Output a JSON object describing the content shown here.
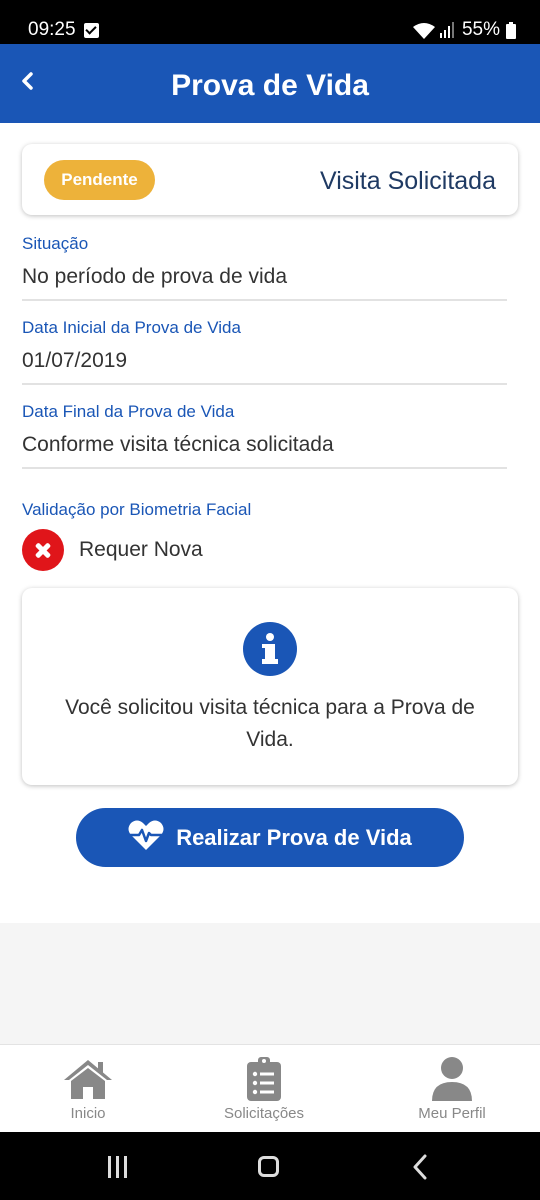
{
  "status_bar": {
    "time": "09:25",
    "battery": "55%"
  },
  "header": {
    "title": "Prova de Vida"
  },
  "status_card": {
    "badge": "Pendente",
    "status": "Visita Solicitada"
  },
  "fields": [
    {
      "label": "Situação",
      "value": "No período de prova de vida"
    },
    {
      "label": "Data Inicial da Prova de Vida",
      "value": "01/07/2019"
    },
    {
      "label": "Data Final da Prova de Vida",
      "value": "Conforme visita técnica solicitada"
    }
  ],
  "biometry": {
    "label": "Validação por Biometria Facial",
    "status": "Requer Nova"
  },
  "info_card": {
    "message": "Você solicitou visita técnica para a Prova de Vida."
  },
  "action_button": {
    "label": "Realizar Prova de Vida"
  },
  "bottom_nav": [
    {
      "label": "Inicio",
      "icon": "home-icon"
    },
    {
      "label": "Solicitações",
      "icon": "clipboard-list-icon"
    },
    {
      "label": "Meu Perfil",
      "icon": "user-icon"
    }
  ],
  "colors": {
    "primary": "#1a56b6",
    "badge": "#edb23a",
    "error": "#e0151a"
  }
}
